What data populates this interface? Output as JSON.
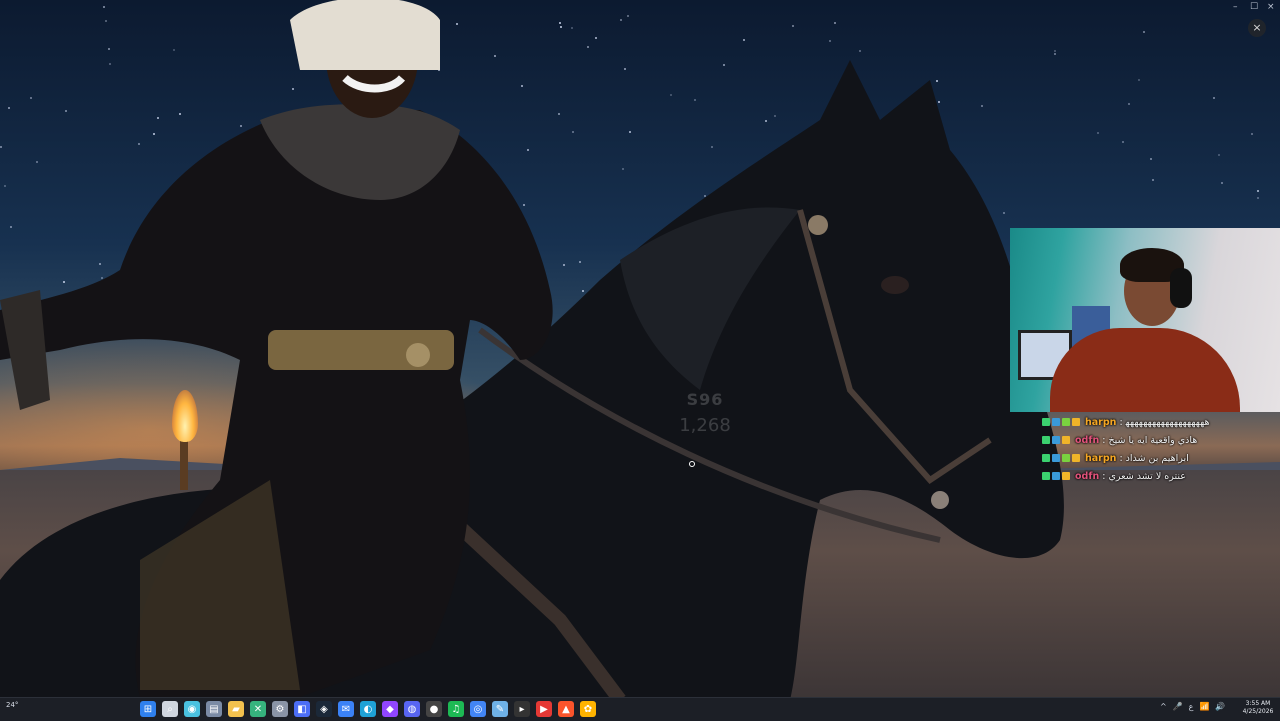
{
  "window": {
    "minimize": "–",
    "maximize": "☐",
    "close": "×",
    "overlay_close": "×"
  },
  "watermark": {
    "logo": "S96",
    "count": "1,268"
  },
  "chat": {
    "messages": [
      {
        "user": "harpn",
        "user_color": "#f5a623",
        "text": ": ﻫﻬﻬﻬﻬﻬﻬﻬﻬﻬﻬﻬﻬﻬﻬﻬﻬﻬﻬ"
      },
      {
        "user": "odfn",
        "user_color": "#e0527a",
        "text": ": هاذي واقعية ايه يا شيخ"
      },
      {
        "user": "harpn",
        "user_color": "#f5a623",
        "text": ": ابراهيم بن شداد"
      },
      {
        "user": "odfn",
        "user_color": "#e0527a",
        "text": ": عنتره لا تشد شعري"
      }
    ]
  },
  "taskbar": {
    "weather": "24°",
    "icons": [
      "windows-start-icon",
      "search-icon",
      "copilot-icon",
      "task-view-icon",
      "file-explorer-icon",
      "xbox-icon",
      "settings-icon",
      "store-icon",
      "steam-icon",
      "mail-icon",
      "edge-icon",
      "twitch-icon",
      "discord-icon",
      "obs-icon",
      "spotify-icon",
      "chrome-icon",
      "notepad-icon",
      "terminal-icon",
      "youtube-icon",
      "brave-icon",
      "photos-icon"
    ],
    "tray": [
      "^",
      "🎤",
      "ع",
      "📶",
      "🔊"
    ],
    "time": "3:55 AM",
    "date": "4/25/2026"
  }
}
